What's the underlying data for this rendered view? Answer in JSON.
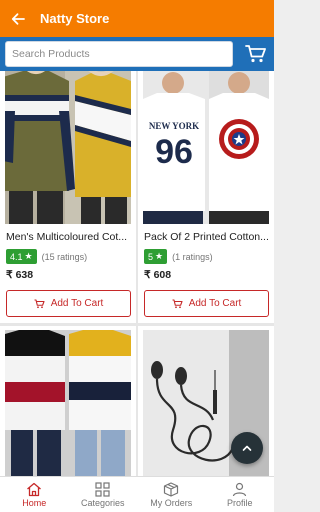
{
  "app": {
    "title": "Natty Store",
    "colors": {
      "appbar": "#f57c00",
      "searchbar": "#1f6fb8",
      "accent": "#c62828",
      "rating_badge": "#2e9e33"
    }
  },
  "search": {
    "placeholder": "Search Products"
  },
  "products": [
    {
      "name": "Men's Multicoloured Cot...",
      "rating": "4.1",
      "rating_count": "(15 ratings)",
      "price": "₹ 638",
      "add_label": "Add To Cart"
    },
    {
      "name": "Pack Of 2 Printed Cotton...",
      "rating": "5",
      "rating_count": "(1 ratings)",
      "price": "₹ 608",
      "add_label": "Add To Cart",
      "print_text": "NEW YORK",
      "print_number": "96"
    },
    {
      "name": "",
      "image": "color-block-tees"
    },
    {
      "name": "",
      "image": "earphones"
    }
  ],
  "nav": [
    {
      "label": "Home",
      "icon": "home-icon",
      "active": true
    },
    {
      "label": "Categories",
      "icon": "grid-icon",
      "active": false
    },
    {
      "label": "My Orders",
      "icon": "box-icon",
      "active": false
    },
    {
      "label": "Profile",
      "icon": "person-icon",
      "active": false
    }
  ]
}
